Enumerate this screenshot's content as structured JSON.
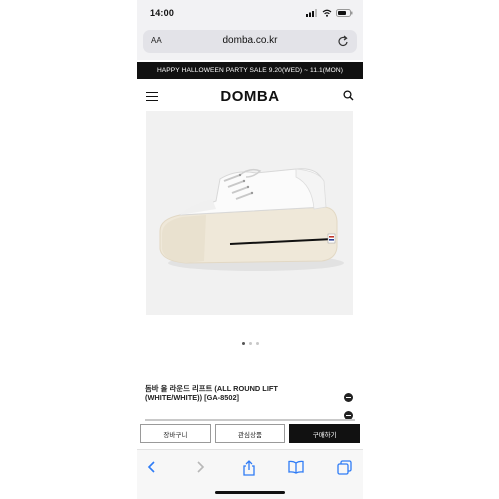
{
  "status": {
    "time": "14:00"
  },
  "browser": {
    "text_size_label": "AA",
    "url": "domba.co.kr"
  },
  "banner": {
    "text": "HAPPY HALLOWEEN PARTY SALE 9.20(WED) ~ 11.1(MON)"
  },
  "site": {
    "logo": "DOMBA"
  },
  "product": {
    "image_icon": "sneaker-image",
    "carousel": {
      "count": 3,
      "active": 1
    },
    "title": "돔바 올 라운드 리프트 (ALL ROUND LIFT (WHITE/WHITE)) [GA-8502]"
  },
  "actions": {
    "cart": "장바구니",
    "wishlist": "관심상품",
    "buy": "구매하기"
  },
  "colors": {
    "banner_bg": "#111111",
    "buy_bg": "#111111"
  }
}
